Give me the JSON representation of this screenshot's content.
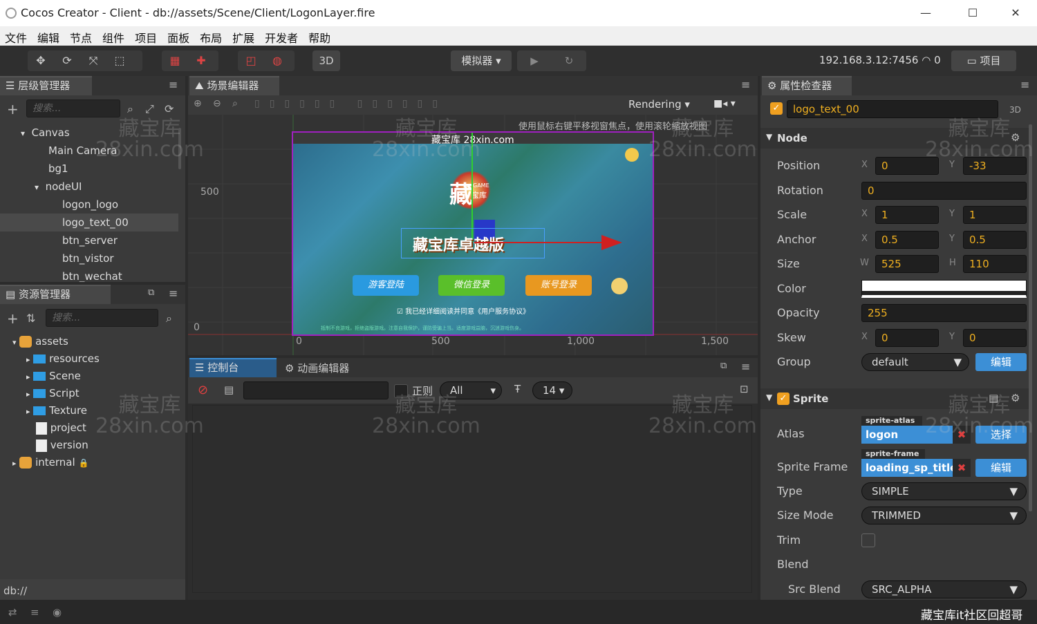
{
  "window": {
    "title": "Cocos Creator - Client - db://assets/Scene/Client/LogonLayer.fire",
    "minimize": "—",
    "maximize": "☐",
    "close": "✕"
  },
  "menu": [
    "文件",
    "编辑",
    "节点",
    "组件",
    "项目",
    "面板",
    "布局",
    "扩展",
    "开发者",
    "帮助"
  ],
  "toolbar": {
    "btn_3d": "3D",
    "simulator": "模拟器 ▾",
    "play": "▶",
    "refresh": "↻",
    "ip": "192.168.3.12:7456",
    "ip_count": "0",
    "project": "项目",
    "colors": {
      "bg": "#2f2f2f",
      "accent": "#3c8fd6"
    }
  },
  "hierarchy": {
    "tab": "层级管理器",
    "search_placeholder": "搜索...",
    "items": [
      {
        "label": "Canvas",
        "arrow": "▾"
      },
      {
        "label": "Main Camera",
        "arrow": ""
      },
      {
        "label": "bg1",
        "arrow": ""
      },
      {
        "label": "nodeUI",
        "arrow": "▾"
      },
      {
        "label": "logon_logo",
        "arrow": ""
      },
      {
        "label": "logo_text_00",
        "arrow": ""
      },
      {
        "label": "btn_server",
        "arrow": ""
      },
      {
        "label": "btn_vistor",
        "arrow": ""
      },
      {
        "label": "btn_wechat",
        "arrow": ""
      }
    ]
  },
  "assets": {
    "tab": "资源管理器",
    "search_placeholder": "搜索...",
    "items": [
      {
        "label": "assets",
        "arrow": "▾",
        "type": "db"
      },
      {
        "label": "resources",
        "arrow": "▸",
        "type": "folder"
      },
      {
        "label": "Scene",
        "arrow": "▸",
        "type": "folder"
      },
      {
        "label": "Script",
        "arrow": "▸",
        "type": "folder"
      },
      {
        "label": "Texture",
        "arrow": "▸",
        "type": "folder"
      },
      {
        "label": "project",
        "arrow": "",
        "type": "file"
      },
      {
        "label": "version",
        "arrow": "",
        "type": "file"
      },
      {
        "label": "internal",
        "arrow": "▸",
        "type": "db"
      }
    ],
    "footer": "db://"
  },
  "scene": {
    "tab": "场景编辑器",
    "rendering": "Rendering",
    "hint": "使用鼠标右键平移视窗焦点，使用滚轮缩放视图",
    "y_ticks": [
      "500",
      "0"
    ],
    "x_ticks": [
      "0",
      "500",
      "1,000",
      "1,500"
    ],
    "game": {
      "watermark": "藏宝库 28xin.com",
      "logo_big": "藏",
      "logo_game": "GAME",
      "logo_sub": "宝库",
      "title": "藏宝库卓越版",
      "btn1": "游客登陆",
      "btn2": "微信登录",
      "btn3": "账号登录",
      "agree": "我已经详细阅读并同意《用户服务协议》",
      "footer": "抵制不良游戏，拒绝盗版游戏。注意自我保护，谨防受骗上当。适度游戏益脑，沉迷游戏伤身。"
    }
  },
  "console": {
    "tab": "控制台",
    "tab2": "动画编辑器",
    "regex": "正则",
    "filter": "All",
    "font_size": "14"
  },
  "inspector": {
    "tab": "属性检查器",
    "node_name": "logo_text_00",
    "tag_3d": "3D",
    "node_section": "Node",
    "position": {
      "label": "Position",
      "x": "0",
      "y": "-33"
    },
    "rotation": {
      "label": "Rotation",
      "value": "0"
    },
    "scale": {
      "label": "Scale",
      "x": "1",
      "y": "1"
    },
    "anchor": {
      "label": "Anchor",
      "x": "0.5",
      "y": "0.5"
    },
    "size": {
      "label": "Size",
      "w": "525",
      "h": "110"
    },
    "color": {
      "label": "Color",
      "value": "#ffffff"
    },
    "opacity": {
      "label": "Opacity",
      "value": "255"
    },
    "skew": {
      "label": "Skew",
      "x": "0",
      "y": "0"
    },
    "group": {
      "label": "Group",
      "value": "default",
      "edit": "编辑"
    },
    "sprite_section": "Sprite",
    "atlas": {
      "label": "Atlas",
      "tag": "sprite-atlas",
      "value": "logon",
      "btn": "选择"
    },
    "sprite_frame": {
      "label": "Sprite Frame",
      "tag": "sprite-frame",
      "value": "loading_sp_title",
      "btn": "编辑"
    },
    "type": {
      "label": "Type",
      "value": "SIMPLE"
    },
    "size_mode": {
      "label": "Size Mode",
      "value": "TRIMMED"
    },
    "trim": {
      "label": "Trim"
    },
    "blend": {
      "label": "Blend"
    },
    "src_blend": {
      "label": "Src Blend",
      "value": "SRC_ALPHA"
    },
    "axis_x": "X",
    "axis_y": "Y",
    "axis_w": "W",
    "axis_h": "H"
  },
  "watermark": {
    "cn": "藏宝库",
    "en": "28xin.com"
  },
  "statusbar": {
    "credit": "藏宝库it社区回超哥"
  }
}
